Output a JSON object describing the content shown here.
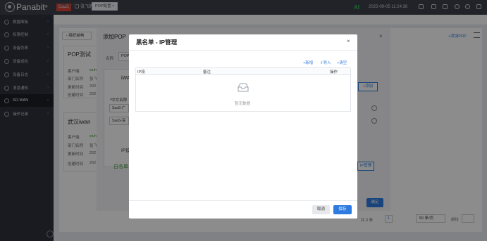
{
  "app": {
    "brand": "Panabit",
    "saas_badge": "SaaS",
    "enterprise": "张飞的企业",
    "ai_label": "AI",
    "datetime": "2025-09-05 11:24:36"
  },
  "sidebar": {
    "items": [
      {
        "label": "数据面板"
      },
      {
        "label": "权限控制"
      },
      {
        "label": "设备列表"
      },
      {
        "label": "设备巡检"
      },
      {
        "label": "设备日志"
      },
      {
        "label": "消息通知"
      },
      {
        "label": "SD-WAN"
      },
      {
        "label": "操作记录"
      }
    ]
  },
  "tabs": [
    {
      "label": "智能应用网关"
    },
    {
      "label": "POP配置"
    }
  ],
  "background": {
    "back_btn": "组织结构",
    "add_pop": "添加POP",
    "card1_title": "POP测试",
    "card2_title": "武汉iwan",
    "card_fields": [
      "客户端",
      "部门名称",
      "更新时间",
      "创建时间"
    ],
    "card1_values": [
      "wuh",
      "张飞",
      "202",
      "202"
    ],
    "card2_values": [
      "wuh",
      "张飞",
      "202",
      "202"
    ],
    "pagination_total": "共 3 条",
    "page_current": "1",
    "page_size": "50 条/页",
    "goto": "前往"
  },
  "add_pop_dialog": {
    "title": "添加POP",
    "name_label": "名称",
    "name_value": "POP",
    "section_iwan": "iWA",
    "cn_name_label": "*中文名称",
    "row1_value": "SaaS-广",
    "row2_value": "SaaS-深",
    "section_ip": "IP设",
    "whitelist": "白名单",
    "add_btn": "+添加",
    "ip_mgmt_btn": "IP管理",
    "confirm": "确定"
  },
  "blacklist_modal": {
    "title": "黑名单 - IP管理",
    "actions": {
      "add": "+新增",
      "import": "导入",
      "clear": "清空"
    },
    "columns": [
      "IP段",
      "备注",
      "操作"
    ],
    "empty_text": "暂无数据",
    "cancel": "取消",
    "save": "保存"
  }
}
